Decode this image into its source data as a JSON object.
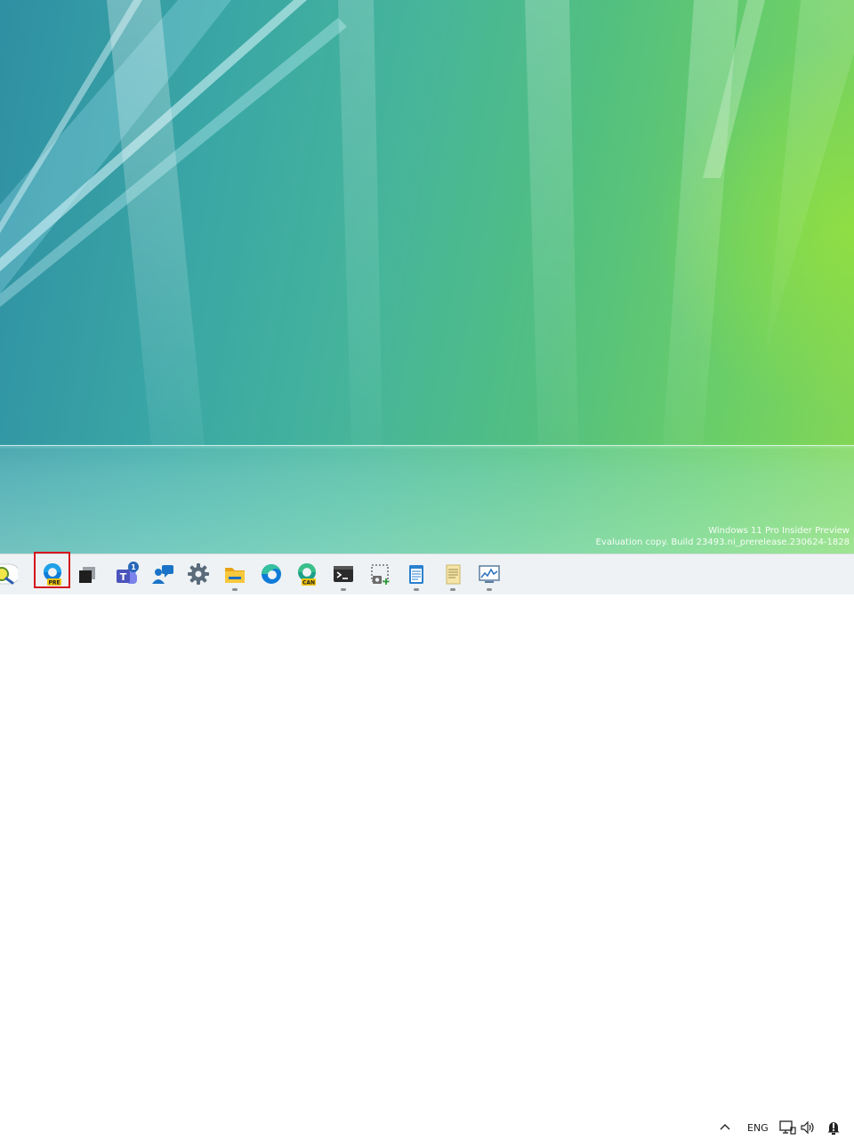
{
  "desktop": {
    "watermark_line1": "Windows 11 Pro Insider Preview",
    "watermark_line2": "Evaluation copy. Build 23493.ni_prerelease.230624-1828"
  },
  "taskbar": {
    "apps": [
      {
        "name": "search",
        "icon": "search-icon"
      },
      {
        "name": "Edge Preview",
        "icon": "edge-preview-icon",
        "badge": "PRE",
        "highlighted": true
      },
      {
        "name": "Task View",
        "icon": "task-view-icon"
      },
      {
        "name": "Teams",
        "icon": "teams-icon",
        "badge": "1"
      },
      {
        "name": "Feedback Hub",
        "icon": "feedback-icon"
      },
      {
        "name": "Settings",
        "icon": "gear-icon"
      },
      {
        "name": "File Explorer",
        "icon": "folder-icon",
        "running": true
      },
      {
        "name": "Microsoft Edge",
        "icon": "edge-icon"
      },
      {
        "name": "Edge Canary",
        "icon": "edge-canary-icon",
        "badge": "CAN"
      },
      {
        "name": "Terminal",
        "icon": "terminal-icon",
        "running": true
      },
      {
        "name": "Snipping Tool",
        "icon": "snipping-tool-icon"
      },
      {
        "name": "Notepad",
        "icon": "notepad-icon",
        "running": true
      },
      {
        "name": "Notepad++",
        "icon": "notes-icon",
        "running": true
      },
      {
        "name": "Resource Monitor",
        "icon": "monitor-chart-icon",
        "running": true
      }
    ],
    "tray": {
      "chevron": "chevron-up-icon",
      "language": "ENG",
      "network": "network-icon",
      "volume": "volume-icon",
      "notifications": "notification-icon"
    }
  },
  "colors": {
    "highlight": "#d4141f",
    "taskbar_bg": "#eef2f4",
    "edge_blue": "#0f7bd8"
  }
}
